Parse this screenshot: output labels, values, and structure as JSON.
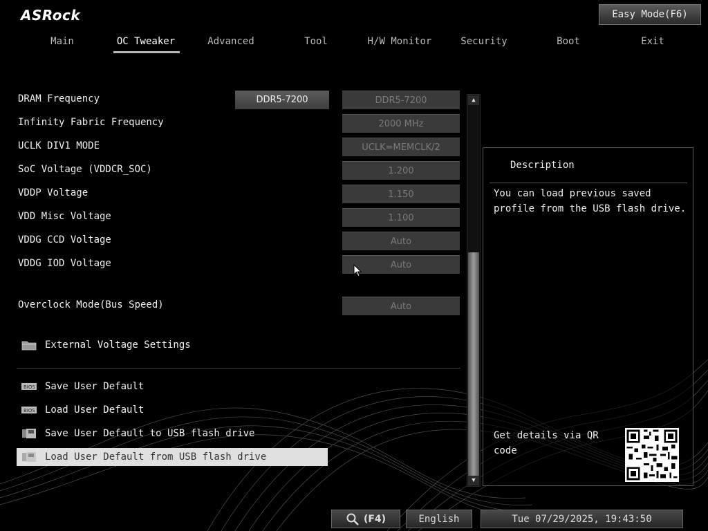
{
  "brand": {
    "logo_text": "ASRock"
  },
  "header": {
    "easy_mode_label": "Easy Mode(F6)"
  },
  "tabs": [
    {
      "label": "Main"
    },
    {
      "label": "OC Tweaker"
    },
    {
      "label": "Advanced"
    },
    {
      "label": "Tool"
    },
    {
      "label": "H/W Monitor"
    },
    {
      "label": "Security"
    },
    {
      "label": "Boot"
    },
    {
      "label": "Exit"
    }
  ],
  "active_tab": "OC Tweaker",
  "settings": [
    {
      "label": "DRAM Frequency",
      "value": "DDR5-7200",
      "default": "DDR5-7200"
    },
    {
      "label": "Infinity Fabric Frequency",
      "value": "2000 MHz"
    },
    {
      "label": "UCLK DIV1 MODE",
      "value": "UCLK=MEMCLK/2"
    },
    {
      "label": "SoC Voltage (VDDCR_SOC)",
      "value": "1.200"
    },
    {
      "label": "VDDP Voltage",
      "value": "1.150"
    },
    {
      "label": "VDD Misc Voltage",
      "value": "1.100"
    },
    {
      "label": "VDDG CCD Voltage",
      "value": "Auto"
    },
    {
      "label": "VDDG IOD Voltage",
      "value": "Auto"
    },
    {
      "label": "Overclock Mode(Bus Speed)",
      "value": "Auto"
    }
  ],
  "submenu": {
    "label": "External Voltage Settings",
    "icon": "folder-icon"
  },
  "actions": [
    {
      "label": "Save User Default",
      "icon": "bios-chip-icon"
    },
    {
      "label": "Load User Default",
      "icon": "bios-chip-icon"
    },
    {
      "label": "Save User Default to USB flash drive",
      "icon": "usb-drive-icon"
    },
    {
      "label": "Load User Default from USB flash drive",
      "icon": "usb-drive-icon"
    }
  ],
  "selected_action": "Load User Default from USB flash drive",
  "description": {
    "title": "Description",
    "text": "You can load previous saved profile from the USB flash drive.",
    "qr_label": "Get details via QR code"
  },
  "footer": {
    "search_label": "(F4)",
    "language": "English",
    "datetime": "Tue 07/29/2025, 19:43:50"
  },
  "colors": {
    "background": "#000000",
    "selected_row": "#e0e0e0",
    "value_box": "#3a3a3a"
  }
}
